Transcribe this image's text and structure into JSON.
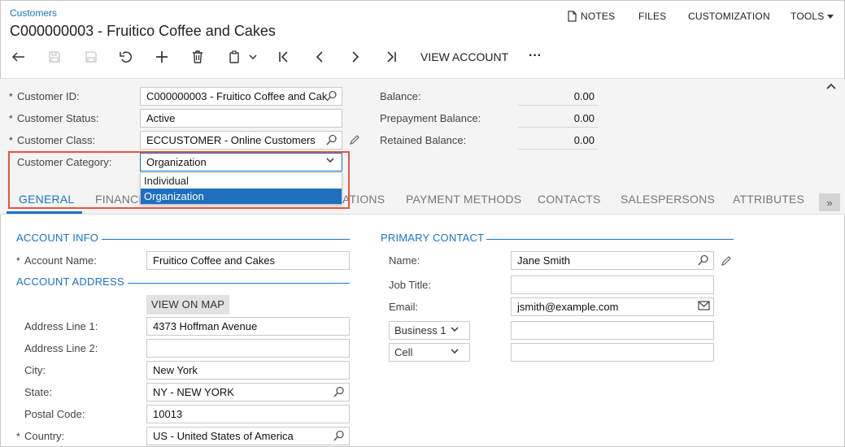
{
  "header": {
    "breadcrumb": "Customers",
    "title": "C000000003 - Fruitico Coffee and Cakes",
    "actions": {
      "notes": "NOTES",
      "files": "FILES",
      "customization": "CUSTOMIZATION",
      "tools": "TOOLS"
    }
  },
  "toolbar": {
    "view_account": "VIEW ACCOUNT",
    "more": "···"
  },
  "summary": {
    "customer_id_label": "Customer ID:",
    "customer_id_value": "C000000003 - Fruitico Coffee and Cak",
    "customer_status_label": "Customer Status:",
    "customer_status_value": "Active",
    "customer_class_label": "Customer Class:",
    "customer_class_value": "ECCUSTOMER - Online Customers",
    "customer_category_label": "Customer Category:",
    "customer_category_value": "Organization",
    "balance_label": "Balance:",
    "balance_value": "0.00",
    "prepayment_balance_label": "Prepayment Balance:",
    "prepayment_balance_value": "0.00",
    "retained_balance_label": "Retained Balance:",
    "retained_balance_value": "0.00"
  },
  "category_dropdown": {
    "options": [
      "Individual",
      "Organization"
    ],
    "selected": "Organization"
  },
  "tabs": {
    "general": "GENERAL",
    "financial": "FINANCI",
    "locations": "ATIONS",
    "payment_methods": "PAYMENT METHODS",
    "contacts": "CONTACTS",
    "salespersons": "SALESPERSONS",
    "attributes": "ATTRIBUTES",
    "more": "»"
  },
  "account_info": {
    "title": "ACCOUNT INFO",
    "account_name_label": "Account Name:",
    "account_name_value": "Fruitico Coffee and Cakes"
  },
  "account_address": {
    "title": "ACCOUNT ADDRESS",
    "view_on_map": "VIEW ON MAP",
    "address1_label": "Address Line 1:",
    "address1_value": "4373 Hoffman Avenue",
    "address2_label": "Address Line 2:",
    "address2_value": "",
    "city_label": "City:",
    "city_value": "New York",
    "state_label": "State:",
    "state_value": "NY - NEW YORK",
    "postal_label": "Postal Code:",
    "postal_value": "10013",
    "country_label": "Country:",
    "country_value": "US - United States of America"
  },
  "primary_contact": {
    "title": "PRIMARY CONTACT",
    "name_label": "Name:",
    "name_value": "Jane Smith",
    "job_title_label": "Job Title:",
    "job_title_value": "",
    "email_label": "Email:",
    "email_value": "jsmith@example.com",
    "phone1_type": "Business 1",
    "phone1_value": "",
    "phone2_type": "Cell",
    "phone2_value": ""
  },
  "colors": {
    "accent": "#1a73c9",
    "highlight_border": "#e8553c",
    "selected_option": "#1f6fbf"
  }
}
